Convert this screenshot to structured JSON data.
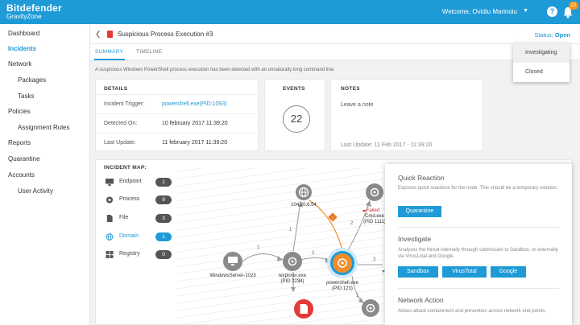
{
  "app": {
    "brand": "Bitdefender",
    "product": "GravityZone",
    "welcome": "Welcome, Ovidiu Marinoiu",
    "notifications": "22"
  },
  "sidebar": {
    "items": [
      {
        "label": "Dashboard"
      },
      {
        "label": "Incidents"
      },
      {
        "label": "Network"
      },
      {
        "label": "Packages"
      },
      {
        "label": "Tasks"
      },
      {
        "label": "Policies"
      },
      {
        "label": "Assignment Rules"
      },
      {
        "label": "Reports"
      },
      {
        "label": "Quarantine"
      },
      {
        "label": "Accounts"
      },
      {
        "label": "User Activity"
      }
    ]
  },
  "header": {
    "title": "Suspicious Process Execution #3",
    "status_label": "Status:",
    "status_value": "Open"
  },
  "tabs": [
    {
      "label": "SUMMARY"
    },
    {
      "label": "TIMELINE"
    }
  ],
  "description": "A suspicious Windows PowerShell process execution has been detected with an unnaturally long command line.",
  "details": {
    "title": "DETAILS",
    "rows": [
      {
        "label": "Incident Trigger:",
        "value": "powershell.exe(PID:1093)"
      },
      {
        "label": "Detected On:",
        "value": "10 february 2017 11:39:20"
      },
      {
        "label": "Last Update:",
        "value": "11 february 2017 11:39:20"
      }
    ]
  },
  "events": {
    "title": "EVENTS",
    "count": "22"
  },
  "notes": {
    "title": "NOTES",
    "placeholder": "Leave a note",
    "last_update": "Last Update: 11 Feb 2017 - 11:39:20"
  },
  "incident_map": {
    "title": "INCIDENT MAP:",
    "legend": [
      {
        "label": "Endpoint",
        "count": "1",
        "icon": "monitor-icon"
      },
      {
        "label": "Process",
        "count": "9",
        "icon": "process-icon"
      },
      {
        "label": "File",
        "count": "3",
        "icon": "file-icon"
      },
      {
        "label": "Domain",
        "count": "1",
        "icon": "globe-icon"
      },
      {
        "label": "Registry",
        "count": "0",
        "icon": "registry-icon"
      }
    ],
    "nodes": {
      "endpoint": "WindowsServer-1023",
      "domain": "104.20.6.54",
      "iexplorer": "iexplorer.exe",
      "iexplorer_pid": "(PID 2234)",
      "powershell": "powershell.exe",
      "powershell_pid": "(PID 123)",
      "cmd_status": "Failed",
      "cmd": "Cmd.exe",
      "cmd_pid": "(PID 1111)",
      "right_partial": "F"
    },
    "edges": [
      "1",
      "2",
      "3",
      "1",
      "2",
      "3",
      "1"
    ]
  },
  "panel": {
    "quick_reaction": {
      "title": "Quick Reaction",
      "desc": "Exposes quick reactions for the node. This should be a temporary solution.",
      "button": "Quarantine"
    },
    "investigate": {
      "title": "Investigate",
      "desc": "Analyzes the threat internally through submission to Sandbox, or externally via Virus1otal and Google.",
      "buttons": [
        "Sandbox",
        "VirusTotal",
        "Google"
      ]
    },
    "network_action": {
      "title": "Network Action",
      "desc": "Allows attack containment and prevention across network end-points."
    }
  },
  "status_menu": {
    "options": [
      "Investigating",
      "Closed"
    ]
  }
}
